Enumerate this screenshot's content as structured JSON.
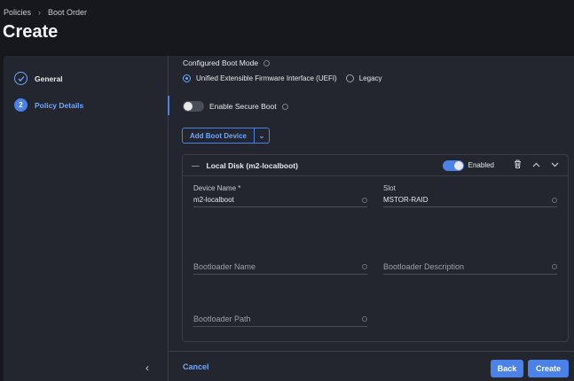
{
  "breadcrumb": {
    "items": [
      "Policies",
      "Boot Order"
    ]
  },
  "page_title": "Create",
  "steps": [
    {
      "label": "General",
      "state": "complete"
    },
    {
      "label": "Policy Details",
      "number": "2",
      "state": "active"
    }
  ],
  "boot_mode": {
    "label": "Configured Boot Mode",
    "options": [
      "Unified Extensible Firmware Interface (UEFI)",
      "Legacy"
    ],
    "selected": "Unified Extensible Firmware Interface (UEFI)"
  },
  "secure_boot": {
    "label": "Enable Secure Boot",
    "enabled": false
  },
  "add_boot_device": {
    "label": "Add Boot Device"
  },
  "device_card": {
    "title": "Local Disk (m2-localboot)",
    "enabled_label": "Enabled",
    "enabled": true,
    "device_name": {
      "label": "Device Name *",
      "value": "m2-localboot"
    },
    "slot": {
      "label": "Slot",
      "value": "MSTOR-RAID"
    },
    "bootloader_name": {
      "placeholder": "Bootloader Name"
    },
    "bootloader_description": {
      "placeholder": "Bootloader Description"
    },
    "bootloader_path": {
      "placeholder": "Bootloader Path"
    }
  },
  "footer": {
    "cancel": "Cancel",
    "back": "Back",
    "create": "Create"
  },
  "colors": {
    "accent": "#4a82e8",
    "link": "#6ea6ff",
    "panel": "#23262e",
    "background": "#17181d"
  }
}
